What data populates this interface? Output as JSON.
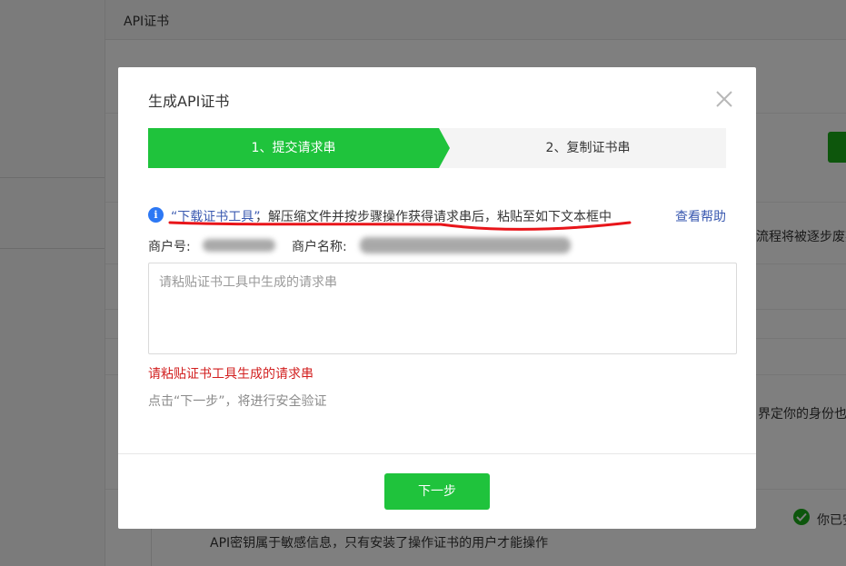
{
  "background": {
    "card_title": "API证书",
    "notice_text": "流程将被逐步废弃",
    "identity_text": "界定你的身份也",
    "installed_text": "你已安",
    "api_key_note": "API密钥属于敏感信息，只有安装了操作证书的用户才能操作"
  },
  "modal": {
    "title": "生成API证书",
    "steps": [
      {
        "label": "1、提交请求串",
        "active": true
      },
      {
        "label": "2、复制证书串",
        "active": false
      }
    ],
    "tip": {
      "link_text": "“下载证书工具”",
      "text": "，解压缩文件并按步骤操作获得请求串后，粘贴至如下文本框中",
      "help_link": "查看帮助"
    },
    "merchant": {
      "id_label": "商户号:",
      "name_label": "商户名称:"
    },
    "request_input": {
      "placeholder": "请粘贴证书工具中生成的请求串",
      "value": ""
    },
    "error_text": "请粘贴证书工具生成的请求串",
    "hint_text": "点击“下一步”，将进行安全验证",
    "next_button": "下一步"
  },
  "colors": {
    "primary_green": "#1fc33c",
    "link_blue": "#3a59b0",
    "error_red": "#d21f1f",
    "annotation_red": "#e8151a"
  },
  "icons": {
    "info": "info-icon",
    "close": "close-icon",
    "check": "check-icon"
  }
}
